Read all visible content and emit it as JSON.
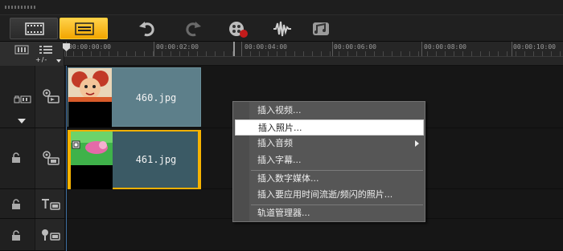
{
  "toolbar": {
    "buttons": [
      {
        "name": "storyboard-view-icon"
      },
      {
        "name": "timeline-view-icon"
      },
      {
        "name": "undo-icon"
      },
      {
        "name": "redo-icon"
      },
      {
        "name": "record-capture-icon"
      },
      {
        "name": "sound-mixer-icon"
      },
      {
        "name": "auto-music-icon"
      }
    ]
  },
  "ruler": {
    "zoom_label": "+/-",
    "ticks": [
      "00:00:00:00",
      "00:00:02:00",
      "00:00:04:00",
      "00:00:06:00",
      "00:00:08:00",
      "00:00:10:00"
    ]
  },
  "clips": [
    {
      "label": "460.jpg"
    },
    {
      "label": "461.jpg"
    }
  ],
  "context_menu": {
    "items": [
      {
        "label": "插入视频..."
      },
      {
        "label": "插入照片..."
      },
      {
        "label": "插入音频"
      },
      {
        "label": "插入字幕..."
      },
      {
        "label": "插入数字媒体..."
      },
      {
        "label": "插入要应用时间流逝/频闪的照片..."
      },
      {
        "label": "轨道管理器..."
      }
    ]
  },
  "colors": {
    "accent": "#f2a500",
    "clip_primary": "#5d7f8a",
    "clip_selected": "#3b5a65"
  }
}
